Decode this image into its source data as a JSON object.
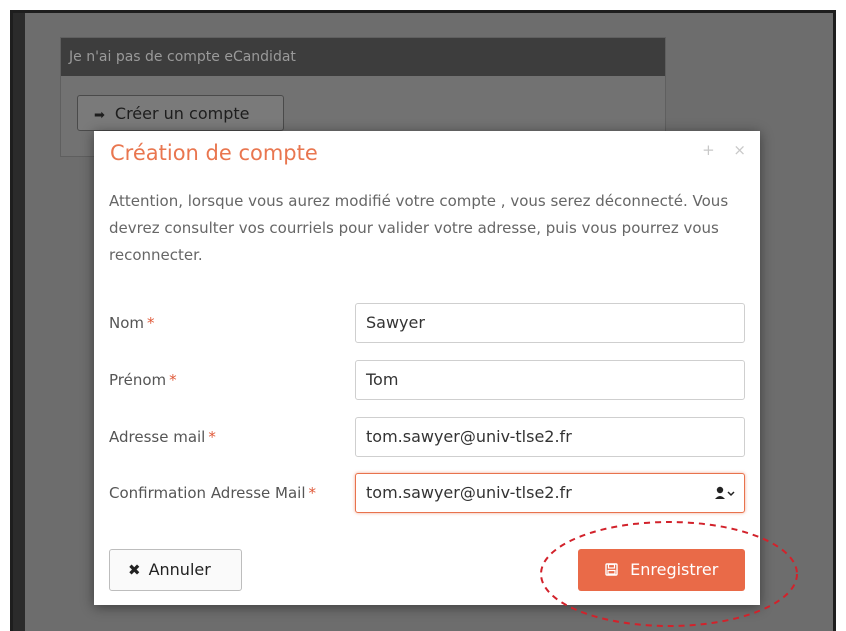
{
  "background": {
    "panel_header": "Je n'ai pas de compte eCandidat",
    "create_button_icon": "sign-in-icon",
    "create_button_label": "Créer un compte"
  },
  "modal": {
    "title": "Création de compte",
    "controls": {
      "maximize": "+",
      "close": "×"
    },
    "message": "Attention, lorsque vous aurez modifié votre compte , vous serez déconnecté. Vous devrez consulter vos courriels pour valider votre adresse, puis vous pourrez vous reconnecter.",
    "required_marker": "*",
    "fields": [
      {
        "label": "Nom",
        "value": "Sawyer"
      },
      {
        "label": "Prénom",
        "value": "Tom"
      },
      {
        "label": "Adresse mail",
        "value": "tom.sawyer@univ-tlse2.fr"
      },
      {
        "label": "Confirmation Adresse Mail",
        "value": "tom.sawyer@univ-tlse2.fr",
        "focused": true,
        "icon": "person-dropdown-icon"
      }
    ],
    "cancel_label": "Annuler",
    "cancel_icon": "times-icon",
    "save_label": "Enregistrer",
    "save_icon": "save-icon"
  },
  "colors": {
    "accent": "#e96a48",
    "title": "#e9764f",
    "overlay": "#6d6d6d",
    "annotation": "#d2222b"
  }
}
